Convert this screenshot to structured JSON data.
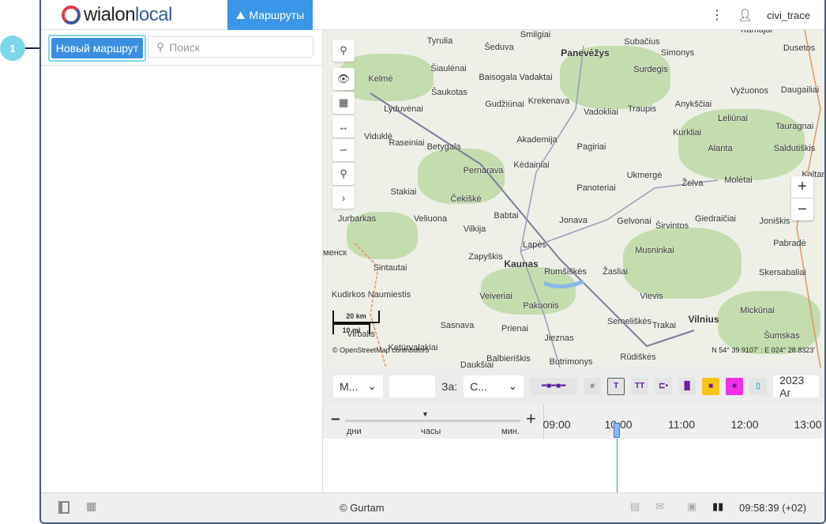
{
  "header": {
    "logo": "wialonlocal",
    "nav_tab": "Маршруты",
    "user": "civi_trace"
  },
  "sidebar": {
    "new_route_button": "Новый маршрут",
    "search_placeholder": "Поиск"
  },
  "callout": "1",
  "map": {
    "cities": [
      "Smilgiai",
      "Tyrulia",
      "Šeduva",
      "Panevėžys",
      "Subačius",
      "Simonys",
      "Kamajai",
      "Dusetos",
      "Šiaulėnai",
      "Baisogala Vadaktai",
      "Surdegis",
      "Kelmė",
      "Šaukotas",
      "Krekenava",
      "Anykščiai",
      "Vyžuonos",
      "Daugailiai",
      "Gudžiūnai",
      "Vadokliai",
      "Traupis",
      "Lyduvėnai",
      "Leliūnai",
      "Tauragnai",
      "Viduklė",
      "Akademija",
      "Pagiriai",
      "Kurkliai",
      "Raseiniai",
      "Betygala",
      "Alanta",
      "Saldutiškis",
      "Kėdainiai",
      "Pernarava",
      "Ukmergė",
      "Želva",
      "Molėtai",
      "Kaltan",
      "Panoteriai",
      "Stakiai",
      "Čekiškė",
      "Babtai",
      "Jurbarkas",
      "Veliuona",
      "Vilkija",
      "Jonava",
      "Gelvonai",
      "Širvintos",
      "Giedraičiai",
      "Joniškis",
      "Lapės",
      "Zapyškis",
      "Musninkai",
      "Pabradė",
      "Kaunas",
      "Rumšiškės",
      "Žasliai",
      "Skersabaliai",
      "Sintautai",
      "Kudirkos Naumiestis",
      "Veiveriai",
      "Vievis",
      "Pakuonis",
      "Semeliškės",
      "Trakai",
      "Vilnius",
      "Mickūnai",
      "Šumskas",
      "Sasnava",
      "Prienai",
      "Jieznas",
      "Rūdiškės",
      "Daukšiai",
      "Balbieriškis",
      "Butrimonys",
      "Ketūrvalakiai",
      "Virbalis",
      "аменск"
    ],
    "scale_km": "20 km",
    "scale_mi": "10 mi",
    "attribution": "© OpenStreetMap contributors",
    "coordinates": "N 54° 39.9107' : E 024° 28.8323'",
    "zoom_in": "+",
    "zoom_out": "−"
  },
  "toolbar": {
    "select1": "М...",
    "period_label": "За:",
    "select2": "С...",
    "date": "2023 Аг"
  },
  "timeline": {
    "scale_labels": [
      "дни",
      "часы",
      "мин."
    ],
    "minus": "−",
    "plus": "+",
    "ticks": [
      "09:00",
      "10:00",
      "11:00",
      "12:00",
      "13:00"
    ]
  },
  "footer": {
    "copyright": "© Gurtam",
    "time": "09:58:39 (+02)"
  },
  "colors": {
    "accent": "#3a96e8",
    "callout": "#7ed6ea"
  }
}
